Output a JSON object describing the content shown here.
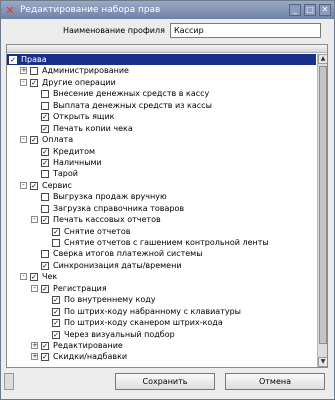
{
  "window": {
    "title": "Редактирование набора прав"
  },
  "profile": {
    "label": "Наименование профиля",
    "value": "Кассир"
  },
  "tree": [
    {
      "label": "Права",
      "level": 0,
      "checked": true,
      "expander": "",
      "selected": true
    },
    {
      "label": "Администрирование",
      "level": 1,
      "checked": false,
      "expander": "+"
    },
    {
      "label": "Другие операции",
      "level": 1,
      "checked": true,
      "expander": "-"
    },
    {
      "label": "Внесение денежных средств в кассу",
      "level": 2,
      "checked": false,
      "expander": ""
    },
    {
      "label": "Выплата денежных средств из кассы",
      "level": 2,
      "checked": false,
      "expander": ""
    },
    {
      "label": "Открыть ящик",
      "level": 2,
      "checked": true,
      "expander": ""
    },
    {
      "label": "Печать копии чека",
      "level": 2,
      "checked": true,
      "expander": ""
    },
    {
      "label": "Оплата",
      "level": 1,
      "checked": true,
      "expander": "-"
    },
    {
      "label": "Кредитом",
      "level": 2,
      "checked": true,
      "expander": ""
    },
    {
      "label": "Наличными",
      "level": 2,
      "checked": true,
      "expander": ""
    },
    {
      "label": "Тарой",
      "level": 2,
      "checked": false,
      "expander": ""
    },
    {
      "label": "Сервис",
      "level": 1,
      "checked": true,
      "expander": "-"
    },
    {
      "label": "Выгрузка продаж вручную",
      "level": 2,
      "checked": false,
      "expander": ""
    },
    {
      "label": "Загрузка справочника товаров",
      "level": 2,
      "checked": false,
      "expander": ""
    },
    {
      "label": "Печать кассовых отчетов",
      "level": 2,
      "checked": true,
      "expander": "-"
    },
    {
      "label": "Снятие отчетов",
      "level": 3,
      "checked": true,
      "expander": ""
    },
    {
      "label": "Снятие отчетов с гашением контрольной ленты",
      "level": 3,
      "checked": false,
      "expander": ""
    },
    {
      "label": "Сверка итогов платежной системы",
      "level": 2,
      "checked": false,
      "expander": ""
    },
    {
      "label": "Синхронизация даты/времени",
      "level": 2,
      "checked": true,
      "expander": ""
    },
    {
      "label": "Чек",
      "level": 1,
      "checked": true,
      "expander": "-"
    },
    {
      "label": "Регистрация",
      "level": 2,
      "checked": true,
      "expander": "-"
    },
    {
      "label": "По внутреннему коду",
      "level": 3,
      "checked": true,
      "expander": ""
    },
    {
      "label": "По штрих-коду набранному с клавиатуры",
      "level": 3,
      "checked": true,
      "expander": ""
    },
    {
      "label": "По штрих-коду сканером штрих-кода",
      "level": 3,
      "checked": true,
      "expander": ""
    },
    {
      "label": "Через визуальный подбор",
      "level": 3,
      "checked": true,
      "expander": ""
    },
    {
      "label": "Редактирование",
      "level": 2,
      "checked": true,
      "expander": "+"
    },
    {
      "label": "Скидки/надбавки",
      "level": 2,
      "checked": true,
      "expander": "+"
    }
  ],
  "buttons": {
    "save": "Сохранить",
    "cancel": "Отмена"
  },
  "icons": {
    "app": "app-logo-icon",
    "close": "close-icon",
    "checkbox_mark": "✓",
    "scroll_up": "arrow-up-icon",
    "scroll_down": "arrow-down-icon"
  },
  "colors": {
    "selection": "#1a2f8c",
    "titlebar": "#7b8db0"
  }
}
